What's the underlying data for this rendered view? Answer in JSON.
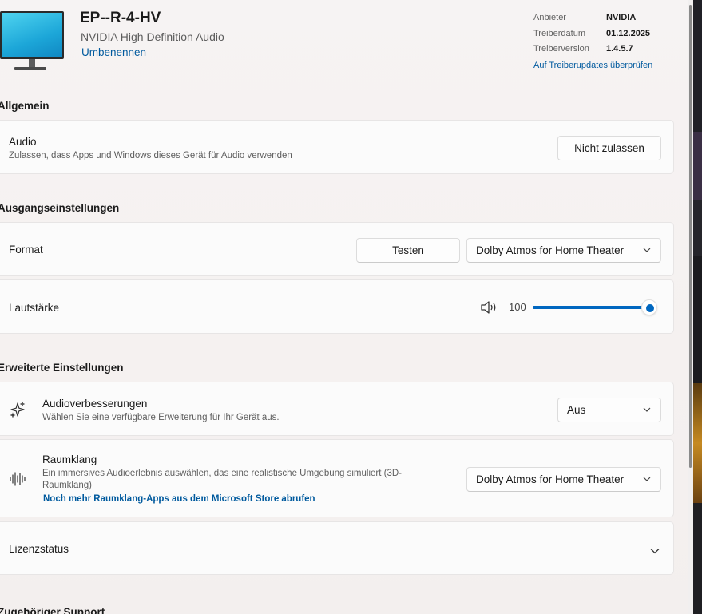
{
  "device": {
    "name": "EP--R-4-HV",
    "driver_name": "NVIDIA High Definition Audio",
    "rename_label": "Umbenennen"
  },
  "driver_info": {
    "rows": [
      {
        "key": "Anbieter",
        "value": "NVIDIA"
      },
      {
        "key": "Treiberdatum",
        "value": "01.12.2025"
      },
      {
        "key": "Treiberversion",
        "value": "1.4.5.7"
      }
    ],
    "update_link": "Auf Treiberupdates überprüfen"
  },
  "sections": {
    "general": "Allgemein",
    "output": "Ausgangseinstellungen",
    "advanced": "Erweiterte Einstellungen",
    "support": "Zugehöriger Support"
  },
  "audio": {
    "label": "Audio",
    "description": "Zulassen, dass Apps und Windows dieses Gerät für Audio verwenden",
    "button": "Nicht zulassen"
  },
  "format": {
    "label": "Format",
    "test_button": "Testen",
    "selected": "Dolby Atmos for Home Theater"
  },
  "volume": {
    "label": "Lautstärke",
    "value": "100",
    "level_percent": 100
  },
  "enhancements": {
    "label": "Audioverbesserungen",
    "description": "Wählen Sie eine verfügbare Erweiterung für Ihr Gerät aus.",
    "selected": "Aus"
  },
  "spatial": {
    "label": "Raumklang",
    "description": "Ein immersives Audioerlebnis auswählen, das eine realistische Umgebung simuliert (3D-Raumklang)",
    "store_link": "Noch mehr Raumklang-Apps aus dem Microsoft Store abrufen",
    "selected": "Dolby Atmos for Home Theater"
  },
  "license": {
    "label": "Lizenzstatus"
  },
  "colors": {
    "accent": "#0067c0",
    "link": "#005a9e"
  }
}
